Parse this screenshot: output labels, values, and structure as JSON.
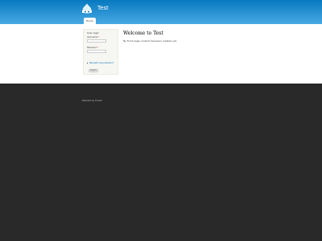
{
  "header": {
    "site_name": "Test",
    "logo_icon": "drupal-logo-icon",
    "nav": [
      {
        "label": "Home"
      }
    ]
  },
  "login_block": {
    "title": "User login",
    "username_label": "Username",
    "password_label": "Password",
    "required_marker": "*",
    "username_value": "",
    "password_value": "",
    "create_account_link": "Request new password",
    "submit_label": "Log in"
  },
  "content": {
    "title": "Welcome to Test",
    "message": "No front page content has been created yet."
  },
  "footer": {
    "credit": "Powered by Drupal"
  },
  "colors": {
    "header_top": "#0779bf",
    "header_bottom": "#48a9e4",
    "footer_bg": "#292929",
    "link": "#0071b3",
    "sidebar_bg": "#f6f6f2"
  }
}
